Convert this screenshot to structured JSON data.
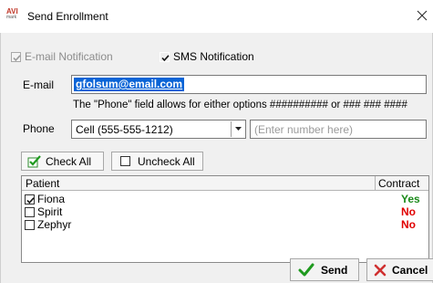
{
  "window": {
    "title": "Send Enrollment",
    "logo_text": "AVI",
    "logo_subtext": "mark"
  },
  "notifications": {
    "email_label": "E-mail Notification",
    "email_checked": true,
    "email_enabled": false,
    "sms_label": "SMS Notification",
    "sms_checked": true
  },
  "email": {
    "label": "E-mail",
    "value": "gfolsum@email.com"
  },
  "phone": {
    "hint": "The \"Phone\" field allows for either options ########## or ### ### ####",
    "label": "Phone",
    "selected_option": "Cell (555-555-1212)",
    "number_placeholder": "(Enter number here)"
  },
  "toolbar": {
    "check_all_label": "Check All",
    "uncheck_all_label": "Uncheck All"
  },
  "patients_table": {
    "columns": [
      "Patient",
      "Contract"
    ],
    "rows": [
      {
        "name": "Fiona",
        "checked": true,
        "contract": "Yes",
        "contract_color": "#1a8a1a"
      },
      {
        "name": "Spirit",
        "checked": false,
        "contract": "No",
        "contract_color": "#e00000"
      },
      {
        "name": "Zephyr",
        "checked": false,
        "contract": "No",
        "contract_color": "#e00000"
      }
    ]
  },
  "actions": {
    "send_label": "Send",
    "cancel_label": "Cancel"
  },
  "colors": {
    "selection": "#0a64d6",
    "send_check": "#1f9a1f",
    "cancel_x": "#d03030"
  }
}
